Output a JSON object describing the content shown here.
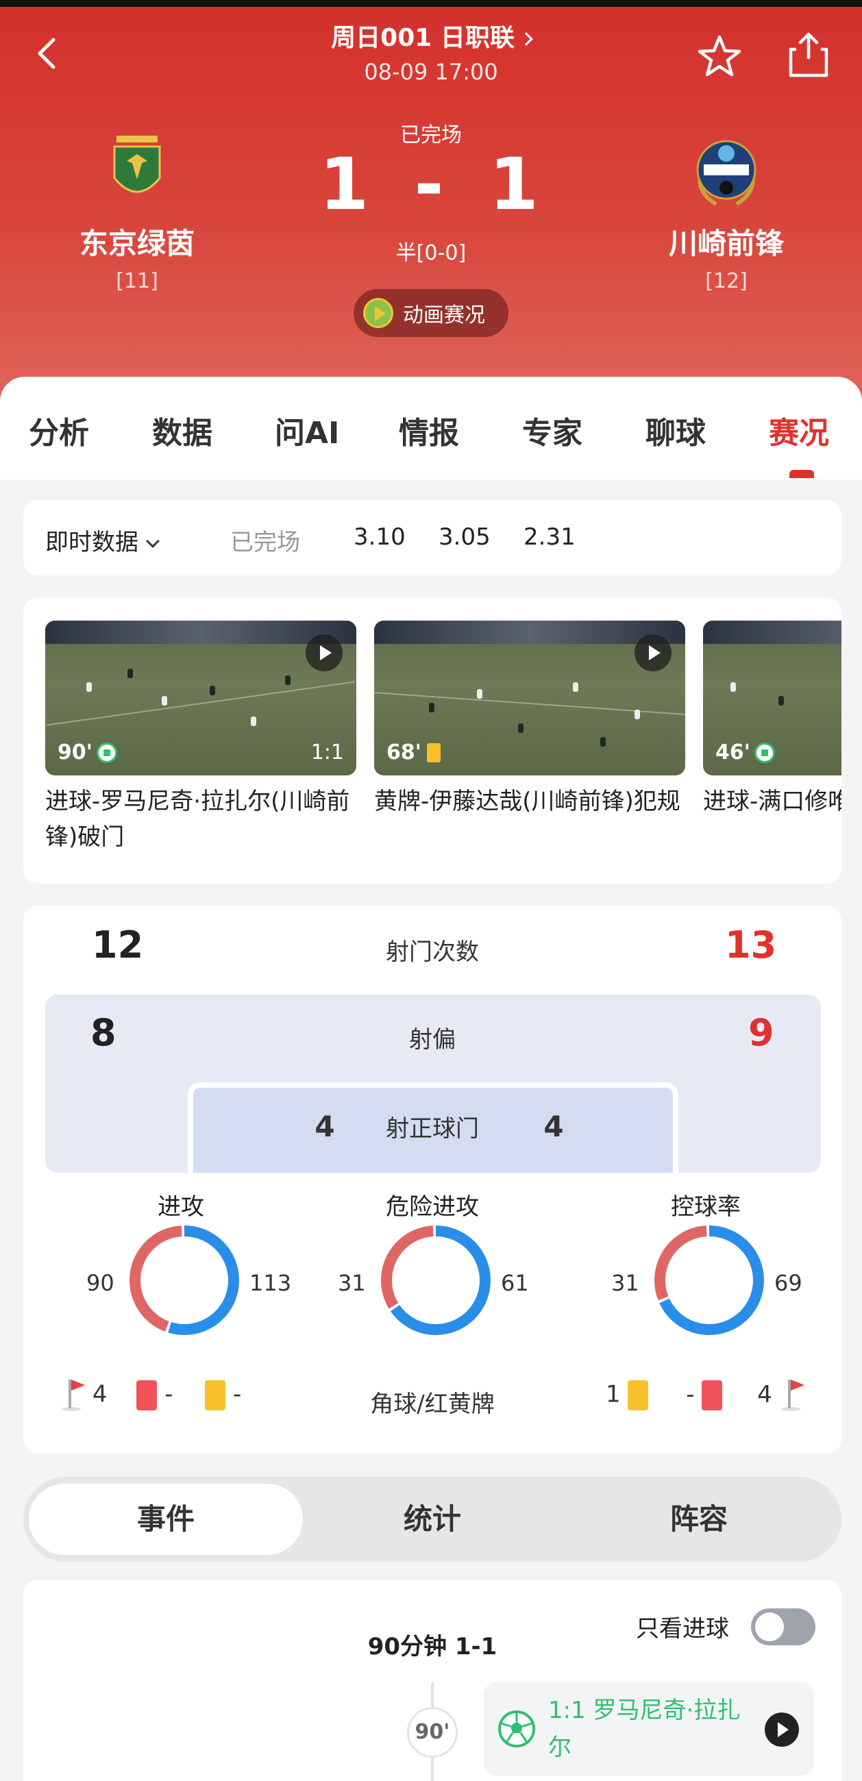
{
  "header": {
    "title": "周日001 日职联",
    "datetime": "08-09 17:00",
    "status": "已完场",
    "score_home": "1",
    "score_sep": "-",
    "score_away": "1",
    "halftime": "半[0-0]",
    "animation_label": "动画赛况",
    "home": {
      "name": "东京绿茵",
      "rank": "[11]",
      "logo": "tokyo-verdy-logo"
    },
    "away": {
      "name": "川崎前锋",
      "rank": "[12]",
      "logo": "kawasaki-frontale-logo"
    }
  },
  "tabs": [
    {
      "label": "分析"
    },
    {
      "label": "数据"
    },
    {
      "label": "问AI"
    },
    {
      "label": "情报"
    },
    {
      "label": "专家"
    },
    {
      "label": "聊球"
    },
    {
      "label": "赛况",
      "active": true
    }
  ],
  "odds": {
    "dropdown_label": "即时数据",
    "status": "已完场",
    "values": [
      "3.10",
      "3.05",
      "2.31"
    ]
  },
  "videos": [
    {
      "minute": "90'",
      "event_icon": "goal-icon",
      "score": "1:1",
      "caption": "进球-罗马尼奇·拉扎尔(川崎前锋)破门"
    },
    {
      "minute": "68'",
      "event_icon": "yellow-card-icon",
      "score": "",
      "caption": "黄牌-伊藤达哉(川崎前锋)犯规"
    },
    {
      "minute": "46'",
      "event_icon": "goal-icon",
      "score": "",
      "caption": "进球-满口修唯月)(东京绿"
    }
  ],
  "stats": {
    "shots": {
      "label": "射门次数",
      "home": "12",
      "away": "13"
    },
    "shots_off": {
      "label": "射偏",
      "home": "8",
      "away": "9"
    },
    "shots_on": {
      "label": "射正球门",
      "home": "4",
      "away": "4"
    },
    "rings": [
      {
        "label": "进攻",
        "home": "90",
        "away": "113",
        "home_value": 90,
        "away_value": 113
      },
      {
        "label": "危险进攻",
        "home": "31",
        "away": "61",
        "home_value": 31,
        "away_value": 61
      },
      {
        "label": "控球率",
        "home": "31",
        "away": "69",
        "home_value": 31,
        "away_value": 69
      }
    ],
    "cards_label": "角球/红黄牌",
    "home_corners": "4",
    "home_red": "-",
    "home_yellow": "-",
    "away_yellow": "1",
    "away_red": "-",
    "away_corners": "4",
    "colors": {
      "home": "#e06666",
      "away": "#2a8de8"
    }
  },
  "segments": [
    {
      "label": "事件",
      "active": true
    },
    {
      "label": "统计"
    },
    {
      "label": "阵容"
    }
  ],
  "events": {
    "header": "90分钟 1-1",
    "filter_label": "只看进球",
    "filter_on": false,
    "items": [
      {
        "minute": "90'",
        "text": "1:1 罗马尼奇·拉扎尔"
      }
    ]
  }
}
